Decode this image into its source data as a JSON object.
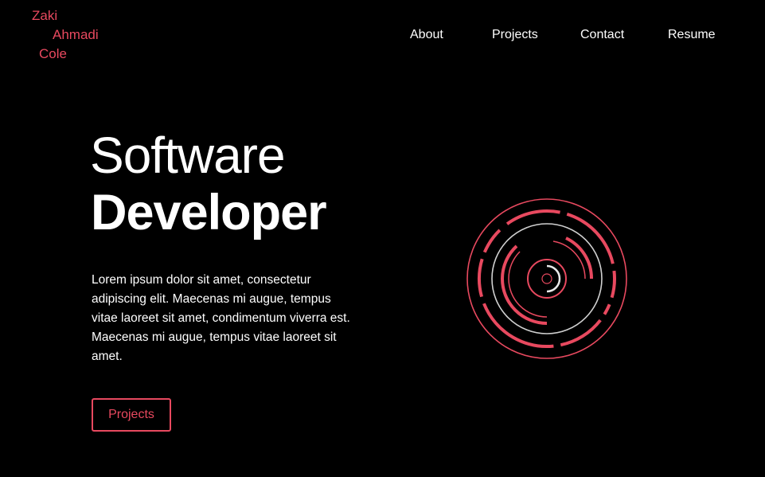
{
  "brand": {
    "line1": "Zaki",
    "line2": "Ahmadi",
    "line3": "Cole",
    "color": "#e8495f"
  },
  "nav": {
    "items": [
      {
        "label": "About"
      },
      {
        "label": "Projects"
      },
      {
        "label": "Contact"
      },
      {
        "label": "Resume"
      }
    ]
  },
  "hero": {
    "title_light": "Software",
    "title_bold": "Developer",
    "description": "Lorem ipsum dolor sit amet, consectetur adipiscing elit. Maecenas mi augue, tempus vitae laoreet sit amet, condimentum viverra est. Maecenas mi augue, tempus vitae laoreet sit amet.",
    "cta_label": "Projects"
  },
  "graphic": {
    "icon": "concentric-rings-icon",
    "accent_color": "#e8495f",
    "secondary_color": "#d0d0d0"
  },
  "colors": {
    "background": "#000000",
    "text": "#ffffff",
    "accent": "#e8495f"
  }
}
